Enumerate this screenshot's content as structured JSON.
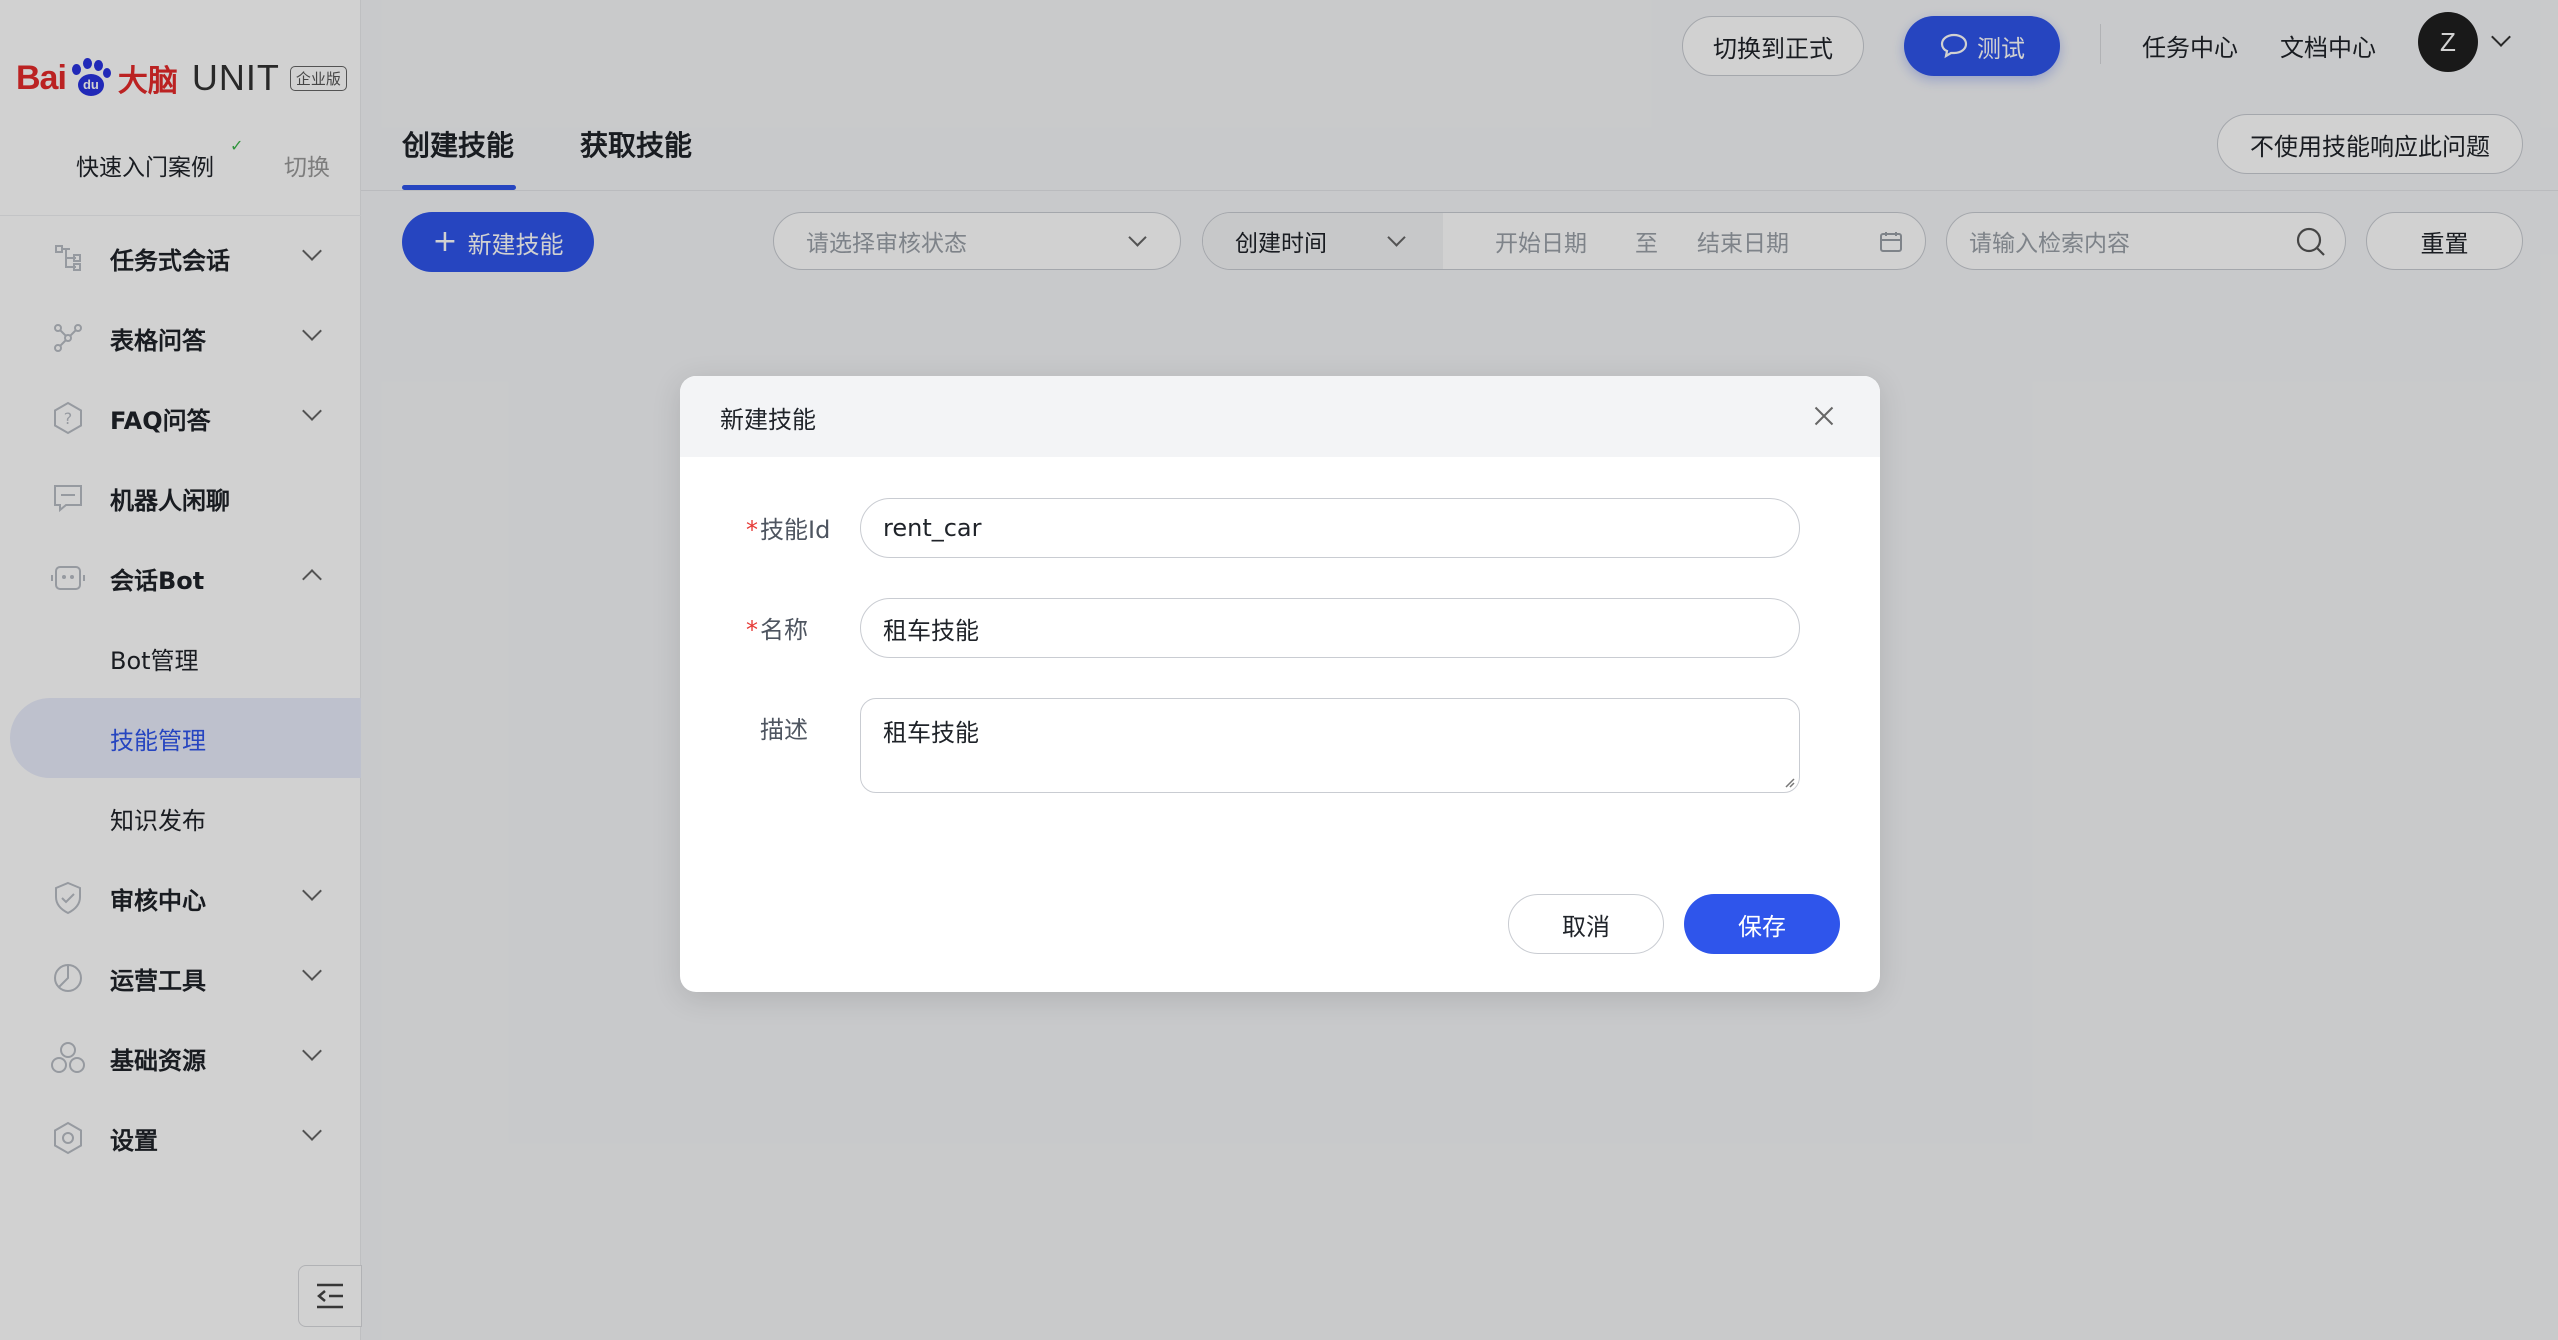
{
  "brand": {
    "logo_bai": "Bai",
    "logo_du": "du",
    "logo_danao": "大脑",
    "product": "UNIT",
    "edition": "企业版"
  },
  "sidebar": {
    "project_label": "快速入门案例",
    "switch_label": "切换",
    "menu": [
      {
        "label": "任务式会话",
        "icon": "task-dialog-icon",
        "expanded": false
      },
      {
        "label": "表格问答",
        "icon": "table-qa-icon",
        "expanded": false
      },
      {
        "label": "FAQ问答",
        "icon": "faq-icon",
        "expanded": false
      },
      {
        "label": "机器人闲聊",
        "icon": "chitchat-icon",
        "expanded": false
      },
      {
        "label": "会话Bot",
        "icon": "bot-icon",
        "expanded": true
      }
    ],
    "bot_sub": [
      {
        "label": "Bot管理",
        "active": false
      },
      {
        "label": "技能管理",
        "active": true
      },
      {
        "label": "知识发布",
        "active": false
      }
    ],
    "menu_after": [
      {
        "label": "审核中心",
        "icon": "shield-icon"
      },
      {
        "label": "运营工具",
        "icon": "ops-tools-icon"
      },
      {
        "label": "基础资源",
        "icon": "resources-icon"
      },
      {
        "label": "设置",
        "icon": "settings-gear-icon"
      }
    ]
  },
  "header": {
    "switch_formal": "切换到正式",
    "test_label": "测试",
    "task_center": "任务中心",
    "doc_center": "文档中心",
    "avatar_letter": "Z"
  },
  "tabs": [
    {
      "label": "创建技能",
      "active": true
    },
    {
      "label": "获取技能",
      "active": false
    }
  ],
  "no_skill_response": "不使用技能响应此问题",
  "toolbar": {
    "new_skill": "新建技能",
    "review_status_placeholder": "请选择审核状态",
    "time_type": "创建时间",
    "start_date": "开始日期",
    "to": "至",
    "end_date": "结束日期",
    "search_placeholder": "请输入检索内容",
    "reset": "重置"
  },
  "modal": {
    "title": "新建技能",
    "fields": {
      "skill_id_label": "技能Id",
      "skill_id_value": "rent_car",
      "name_label": "名称",
      "name_value": "租车技能",
      "desc_label": "描述",
      "desc_value": "租车技能"
    },
    "cancel": "取消",
    "save": "保存"
  },
  "colors": {
    "primary": "#2f55eb",
    "brand_red": "#e52a2a",
    "brand_blue": "#2932e1",
    "required": "#e53935"
  }
}
